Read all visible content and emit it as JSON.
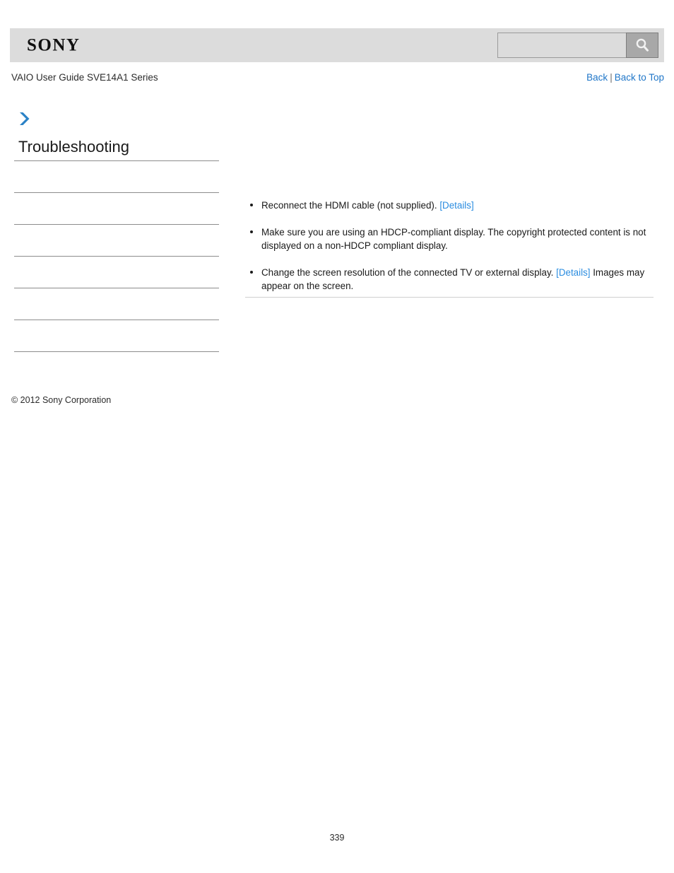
{
  "header": {
    "logo_text": "SONY",
    "search": {
      "value": "",
      "placeholder": "",
      "icon": "search-icon",
      "button_label": ""
    }
  },
  "guide_title": "VAIO User Guide SVE14A1 Series",
  "topnav": {
    "back_label": "Back",
    "separator": "|",
    "back_to_top_label": "Back to Top"
  },
  "sidebar": {
    "breadcrumb_icon": "chevron-right-icon",
    "heading": "Troubleshooting",
    "items": [
      {
        "label": ""
      },
      {
        "label": ""
      },
      {
        "label": ""
      },
      {
        "label": ""
      },
      {
        "label": ""
      },
      {
        "label": ""
      },
      {
        "label": ""
      }
    ],
    "copyright": "© 2012 Sony Corporation"
  },
  "main": {
    "title": "",
    "bullets": [
      {
        "text_before": "Reconnect the HDMI cable (not supplied). ",
        "link": "[Details]",
        "text_after": ""
      },
      {
        "text_before": "Make sure you are using an HDCP-compliant display. The copyright protected content is not displayed on a non-HDCP compliant display.",
        "link": "",
        "text_after": ""
      },
      {
        "text_before": "Change the screen resolution of the connected TV or external display. ",
        "link": "[Details]",
        "text_after": " Images may appear on the screen."
      }
    ]
  },
  "footer": {
    "page_number": "339"
  },
  "colors": {
    "header_band": "#dcdcdc",
    "link_blue": "#1f76c8",
    "details_blue": "#2a8ce0",
    "arrow_blue": "#2b82c6",
    "rule_gray": "#8c8c8c"
  }
}
